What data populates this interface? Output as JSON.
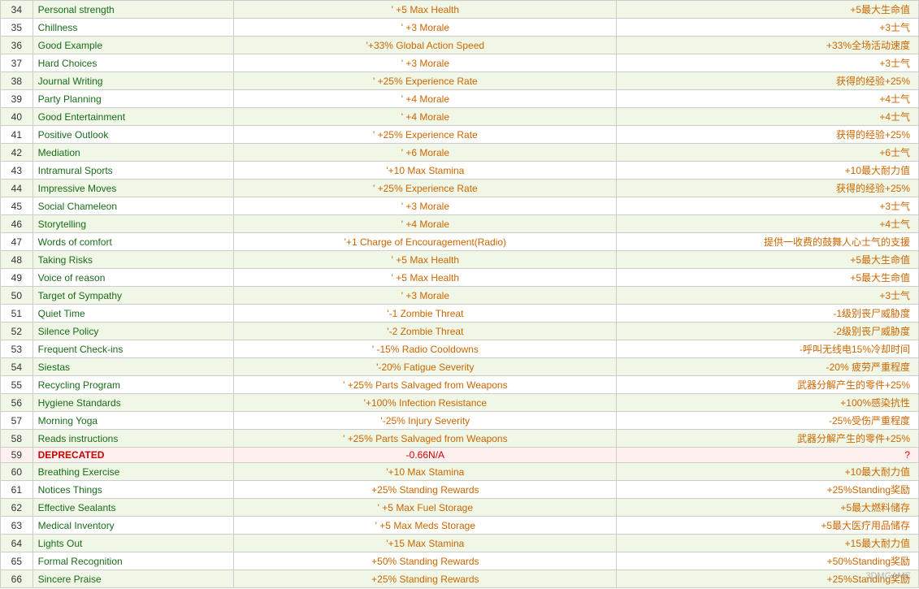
{
  "rows": [
    {
      "num": 34,
      "name": "Personal strength",
      "effect": "' +5 Max Health",
      "cn": "+5最大生命值",
      "even": true,
      "deprecated": false
    },
    {
      "num": 35,
      "name": "Chillness",
      "effect": "' +3 Morale",
      "cn": "+3士气",
      "even": false,
      "deprecated": false
    },
    {
      "num": 36,
      "name": "Good Example",
      "effect": "'+33% Global Action Speed",
      "cn": "+33%全场活动速度",
      "even": true,
      "deprecated": false
    },
    {
      "num": 37,
      "name": "Hard Choices",
      "effect": "' +3 Morale",
      "cn": "+3士气",
      "even": false,
      "deprecated": false
    },
    {
      "num": 38,
      "name": "Journal Writing",
      "effect": "' +25% Experience Rate",
      "cn": "获得的经验+25%",
      "even": true,
      "deprecated": false
    },
    {
      "num": 39,
      "name": "Party Planning",
      "effect": "' +4 Morale",
      "cn": "+4士气",
      "even": false,
      "deprecated": false
    },
    {
      "num": 40,
      "name": "Good Entertainment",
      "effect": "' +4 Morale",
      "cn": "+4士气",
      "even": true,
      "deprecated": false
    },
    {
      "num": 41,
      "name": "Positive Outlook",
      "effect": "' +25% Experience Rate",
      "cn": "获得的经验+25%",
      "even": false,
      "deprecated": false
    },
    {
      "num": 42,
      "name": "Mediation",
      "effect": "' +6 Morale",
      "cn": "+6士气",
      "even": true,
      "deprecated": false
    },
    {
      "num": 43,
      "name": "Intramural Sports",
      "effect": "'+10 Max Stamina",
      "cn": "+10最大耐力值",
      "even": false,
      "deprecated": false
    },
    {
      "num": 44,
      "name": "Impressive Moves",
      "effect": "' +25% Experience Rate",
      "cn": "获得的经验+25%",
      "even": true,
      "deprecated": false
    },
    {
      "num": 45,
      "name": "Social Chameleon",
      "effect": "' +3 Morale",
      "cn": "+3士气",
      "even": false,
      "deprecated": false
    },
    {
      "num": 46,
      "name": "Storytelling",
      "effect": "' +4 Morale",
      "cn": "+4士气",
      "even": true,
      "deprecated": false
    },
    {
      "num": 47,
      "name": "Words of comfort",
      "effect": "'+1 Charge of Encouragement(Radio)",
      "cn": "提供一收费的鼓舞人心士气的支援",
      "even": false,
      "deprecated": false
    },
    {
      "num": 48,
      "name": "Taking Risks",
      "effect": "' +5 Max Health",
      "cn": "+5最大生命值",
      "even": true,
      "deprecated": false
    },
    {
      "num": 49,
      "name": "Voice of reason",
      "effect": "' +5 Max Health",
      "cn": "+5最大生命值",
      "even": false,
      "deprecated": false
    },
    {
      "num": 50,
      "name": "Target of Sympathy",
      "effect": "' +3 Morale",
      "cn": "+3士气",
      "even": true,
      "deprecated": false
    },
    {
      "num": 51,
      "name": "Quiet Time",
      "effect": "'-1 Zombie Threat",
      "cn": "-1级别丧尸威胁度",
      "even": false,
      "deprecated": false
    },
    {
      "num": 52,
      "name": "Silence Policy",
      "effect": "'-2 Zombie Threat",
      "cn": "-2级别丧尸威胁度",
      "even": true,
      "deprecated": false
    },
    {
      "num": 53,
      "name": "Frequent Check-ins",
      "effect": "' -15% Radio Cooldowns",
      "cn": "-呼叫无线电15%冷却时间",
      "even": false,
      "deprecated": false
    },
    {
      "num": 54,
      "name": "Siestas",
      "effect": "'-20% Fatigue Severity",
      "cn": "-20% 疲劳严重程度",
      "even": true,
      "deprecated": false
    },
    {
      "num": 55,
      "name": "Recycling Program",
      "effect": "' +25% Parts Salvaged from Weapons",
      "cn": "武器分解产生的零件+25%",
      "even": false,
      "deprecated": false
    },
    {
      "num": 56,
      "name": "Hygiene Standards",
      "effect": "'+100% Infection Resistance",
      "cn": "+100%感染抗性",
      "even": true,
      "deprecated": false
    },
    {
      "num": 57,
      "name": "Morning Yoga",
      "effect": "'-25% Injury Severity",
      "cn": "-25%受伤严重程度",
      "even": false,
      "deprecated": false
    },
    {
      "num": 58,
      "name": "Reads instructions",
      "effect": "' +25% Parts Salvaged from Weapons",
      "cn": "武器分解产生的零件+25%",
      "even": true,
      "deprecated": false
    },
    {
      "num": 59,
      "name": "DEPRECATED",
      "effect": "-0.66N/A",
      "cn": "?",
      "even": false,
      "deprecated": true
    },
    {
      "num": 60,
      "name": "Breathing Exercise",
      "effect": "'+10 Max Stamina",
      "cn": "+10最大耐力值",
      "even": true,
      "deprecated": false
    },
    {
      "num": 61,
      "name": "Notices Things",
      "effect": "+25% Standing Rewards",
      "cn": "+25%Standing奖励",
      "even": false,
      "deprecated": false
    },
    {
      "num": 62,
      "name": "Effective Sealants",
      "effect": "' +5 Max Fuel Storage",
      "cn": "+5最大燃料储存",
      "even": true,
      "deprecated": false
    },
    {
      "num": 63,
      "name": "Medical Inventory",
      "effect": "' +5 Max Meds Storage",
      "cn": "+5最大医疗用品储存",
      "even": false,
      "deprecated": false
    },
    {
      "num": 64,
      "name": "Lights Out",
      "effect": "'+15 Max Stamina",
      "cn": "+15最大耐力值",
      "even": true,
      "deprecated": false
    },
    {
      "num": 65,
      "name": "Formal Recognition",
      "effect": "+50% Standing Rewards",
      "cn": "+50%Standing奖励",
      "even": false,
      "deprecated": false
    },
    {
      "num": 66,
      "name": "Sincere Praise",
      "effect": "+25% Standing Rewards",
      "cn": "+25%Standing奖励",
      "even": true,
      "deprecated": false
    }
  ]
}
